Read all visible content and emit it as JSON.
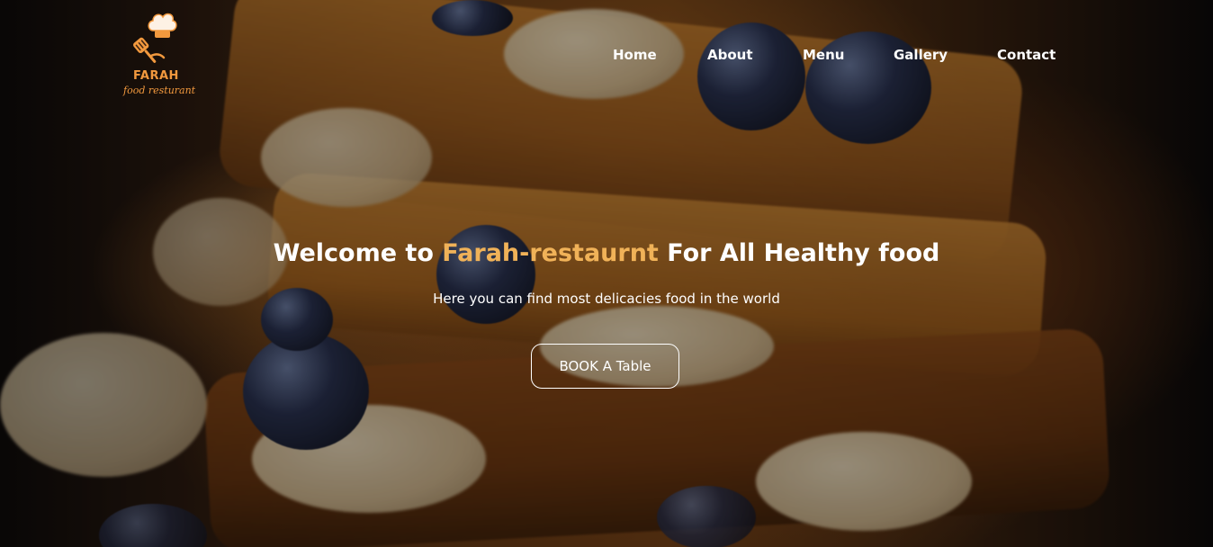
{
  "brand": {
    "name": "FARAH",
    "tagline": "food resturant",
    "color": "#f2993e"
  },
  "nav": {
    "items": [
      {
        "label": "Home"
      },
      {
        "label": "About"
      },
      {
        "label": "Menu"
      },
      {
        "label": "Gallery"
      },
      {
        "label": "Contact"
      }
    ]
  },
  "hero": {
    "headline_prefix": "Welcome to ",
    "headline_accent": "Farah-restaurnt",
    "headline_suffix": " For All Healthy food",
    "accent_color": "#f0b258",
    "subtitle": "Here you can find most delicacies food in the world",
    "cta_label": "BOOK A Table"
  }
}
